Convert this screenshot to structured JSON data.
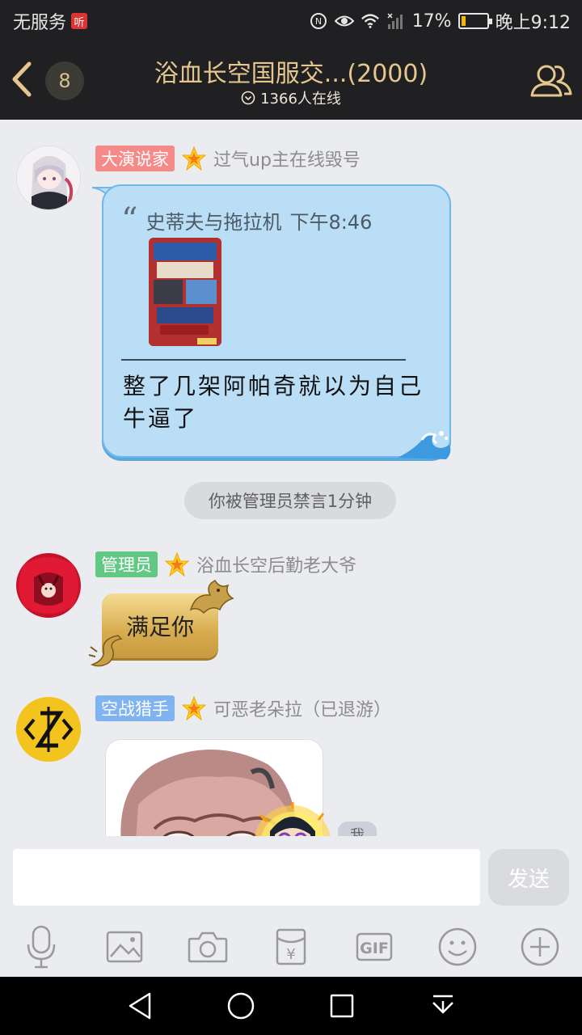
{
  "status_bar": {
    "carrier": "无服务",
    "ting_badge": "听",
    "battery_pct": "17%",
    "battery_level": 0.17,
    "time": "晚上9:12"
  },
  "header": {
    "unread_count": "8",
    "title": "浴血长空国服交...(2000)",
    "online": "1366人在线"
  },
  "messages": [
    {
      "badge": "大演说家",
      "name": "过气up主在线毁号",
      "quote_author": "史蒂夫与拖拉机",
      "quote_time": "下午8:46",
      "text": "整了几架阿帕奇就以为自己牛逼了"
    },
    {
      "badge": "管理员",
      "name": "浴血长空后勤老大爷",
      "text": "满足你"
    },
    {
      "badge": "空战猎手",
      "name": "可恶老朵拉（已退游）"
    }
  ],
  "system_notice": "你被管理员禁言1分钟",
  "me_label": "我",
  "input": {
    "value": "",
    "placeholder": "",
    "send_label": "发送"
  },
  "tools": {
    "gif_label": "GIF",
    "redpacket_symbol": "¥"
  },
  "colors": {
    "accent_gold": "#e5c68c",
    "quote_bubble": "#b9def6",
    "badge_red": "#f58a88",
    "badge_green": "#62c985",
    "badge_blue": "#80b4f0"
  }
}
